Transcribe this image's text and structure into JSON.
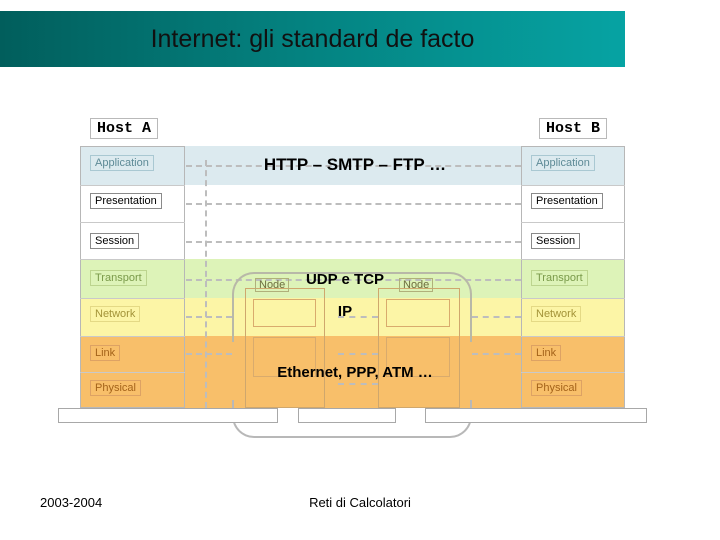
{
  "slide": {
    "title": "Internet: gli standard de facto",
    "banner_gradient_from": "#015e5c",
    "banner_gradient_to": "#06a3a3"
  },
  "hosts": {
    "left_label": "Host A",
    "right_label": "Host B",
    "layers": [
      {
        "name": "Application",
        "color": "#dceaef",
        "text_color": "#5d8a96"
      },
      {
        "name": "Presentation",
        "color": "#ffffff",
        "text_color": "#000000"
      },
      {
        "name": "Session",
        "color": "#ffffff",
        "text_color": "#000000"
      },
      {
        "name": "Transport",
        "color": "#ddf3b8",
        "text_color": "#7a9a4a"
      },
      {
        "name": "Network",
        "color": "#fcf5a6",
        "text_color": "#a39338"
      },
      {
        "name": "Link",
        "color": "#f8bf6a",
        "text_color": "#a4631a"
      },
      {
        "name": "Physical",
        "color": "#f8bf6a",
        "text_color": "#a4631a"
      }
    ]
  },
  "network": {
    "node_left_label": "Node",
    "node_right_label": "Node"
  },
  "protocols": {
    "application": "HTTP – SMTP – FTP …",
    "transport": "UDP e TCP",
    "network": "IP",
    "link": "Ethernet, PPP, ATM …"
  },
  "footer": {
    "date": "2003-2004",
    "course": "Reti di Calcolatori"
  }
}
